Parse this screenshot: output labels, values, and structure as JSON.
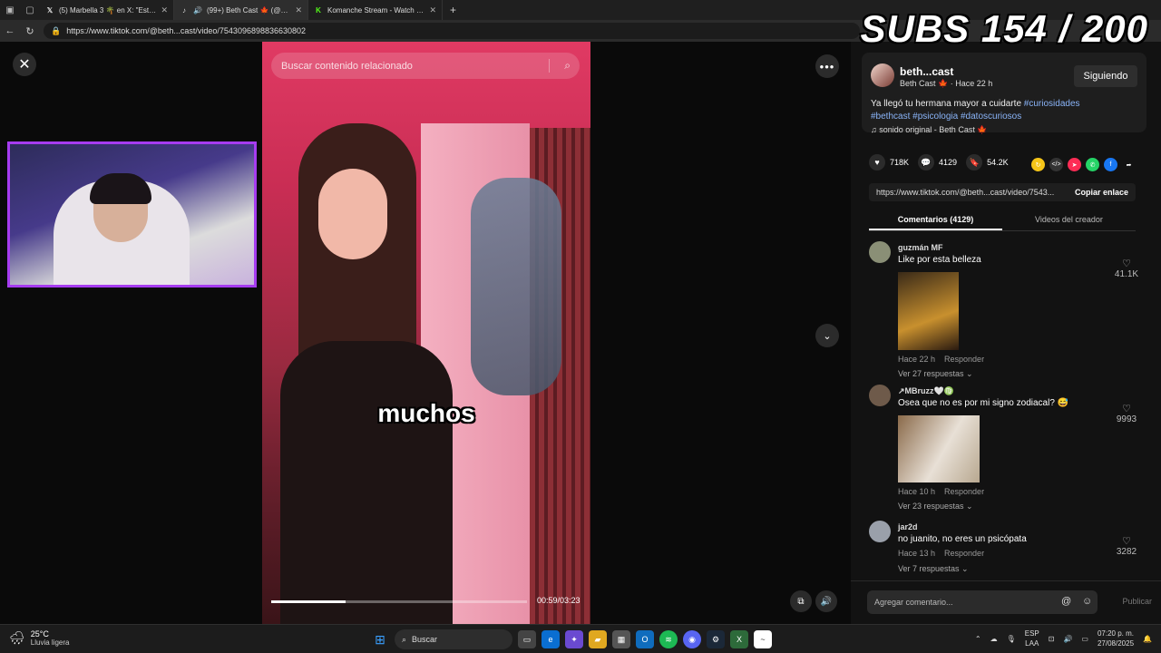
{
  "browser": {
    "tabs": [
      {
        "icon": "x-logo-icon",
        "title": "(5) Marbella 3 🌴 en X: \"Este año..."
      },
      {
        "icon": "tiktok-icon",
        "title": "(99+) Beth Cast 🍁 (@beth..."
      },
      {
        "icon": "kick-icon",
        "title": "Komanche Stream - Watch Live o..."
      }
    ],
    "url": "https://www.tiktok.com/@beth...cast/video/7543096898836630802"
  },
  "overlay": {
    "subs": "SUBS 154 / 200"
  },
  "video": {
    "search_placeholder": "Buscar contenido relacionado",
    "caption": "muchos",
    "timecode": "00:59/03:23",
    "progress_fraction": 0.29
  },
  "author": {
    "username": "beth...cast",
    "display": "Beth Cast 🍁 · Hace 22 h",
    "follow_label": "Siguiendo",
    "desc_text": "Ya llegó tu hermana mayor a cuidarte ",
    "desc_tags": [
      "#curiosidades",
      "#bethcast",
      "#psicologia",
      "#datoscuriosos"
    ],
    "music": "sonido original - Beth Cast 🍁"
  },
  "stats": {
    "likes": "718K",
    "comments": "4129",
    "saves": "54.2K"
  },
  "link": {
    "url": "https://www.tiktok.com/@beth...cast/video/7543...",
    "copy_label": "Copiar enlace"
  },
  "tabs": {
    "comments": "Comentarios (4129)",
    "videos": "Videos del creador"
  },
  "comments": [
    {
      "user": "guzmán MF",
      "text": "Like por esta belleza",
      "time": "Hace 22 h",
      "reply": "Responder",
      "likes": "41.1K",
      "replies": "Ver 27 respuestas ⌄"
    },
    {
      "user": "↗MBruzz🤍♍",
      "text": "Osea que no es por mi signo zodiacal? 😅",
      "time": "Hace 10 h",
      "reply": "Responder",
      "likes": "9993",
      "replies": "Ver 23 respuestas ⌄"
    },
    {
      "user": "jar2d",
      "text": "no juanito, no eres un psicópata",
      "time": "Hace 13 h",
      "reply": "Responder",
      "likes": "3282",
      "replies": "Ver 7 respuestas ⌄"
    }
  ],
  "composer": {
    "placeholder": "Agregar comentario...",
    "publish": "Publicar"
  },
  "taskbar": {
    "temp": "25°C",
    "weather": "Lluvia ligera",
    "search": "Buscar",
    "lang1": "ESP",
    "lang2": "LAA",
    "time": "07:20 p. m.",
    "date": "27/08/2025"
  }
}
